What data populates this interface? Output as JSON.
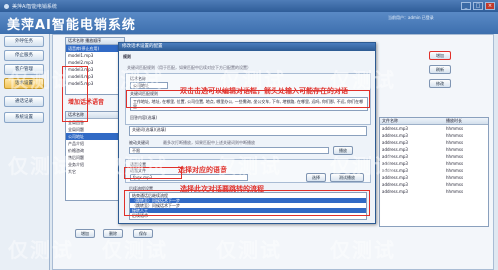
{
  "window": {
    "title": "美萍AI智能电销系统",
    "min": "_",
    "max": "□",
    "close": "×"
  },
  "app_title": "美萍AI智能电销系统",
  "user_info": "当前用户：admin  已登录",
  "sidebar": [
    {
      "label": "外呼任务"
    },
    {
      "label": "停止服务"
    },
    {
      "label": "客户管理"
    },
    {
      "label": "话术设置"
    },
    {
      "label": "通话记录"
    },
    {
      "label": "系统设置"
    }
  ],
  "left_table": {
    "header": "话术名称  播放顺序",
    "subheader": "语音库(停止应用)",
    "rows": [
      "model1.mp3",
      "model2.mp3",
      "model3.mp3",
      "model4.mp3",
      "model5.mp3"
    ]
  },
  "left_table2": {
    "header": "话术名称",
    "rows": [
      "全局回答",
      "全局问题",
      "公司地址",
      "产品介绍",
      "价格咨询",
      "售后问题",
      "业务介绍",
      "其它"
    ]
  },
  "right_table": {
    "headers": [
      "文件名称",
      "播放时长"
    ],
    "rows": [
      {
        "name": "address.mp3",
        "dur": "hhmmss"
      },
      {
        "name": "address.mp3",
        "dur": "hhmmss"
      },
      {
        "name": "address.mp3",
        "dur": "hhmmss"
      },
      {
        "name": "address.mp3",
        "dur": "hhmmss"
      },
      {
        "name": "address.mp3",
        "dur": "hhmmss"
      },
      {
        "name": "address.mp3",
        "dur": "hhmmss"
      },
      {
        "name": "address.mp3",
        "dur": "hhmmss"
      },
      {
        "name": "address.mp3",
        "dur": "hhmmss"
      },
      {
        "name": "address.mp3",
        "dur": "hhmmss"
      },
      {
        "name": "address.mp3",
        "dur": "hhmmss"
      }
    ]
  },
  "top_buttons": {
    "add": "增加",
    "refresh": "刷新",
    "edit": "修改"
  },
  "bottom_buttons": {
    "add": "增加",
    "delete": "删除",
    "save": "保存"
  },
  "dialog": {
    "title": "修改话术设置的配置",
    "section_title": "规则",
    "tip": "关键词匹配规则（用于匹配，如果匹配中后续对应下方已配置的设置）",
    "field1_label": "话术名称",
    "field1_value": "公司地址",
    "keyword_label": "关键词匹配规则",
    "keywords": "工作地址, 地址, 在哪里, 位置, 公司位置, 地点, 哪里办公, 一些需询, 坐公交车, 下车, 地铁路, 在哪里, 远吗, 你们那, 不远, 你们在哪里",
    "answer_label": "回答内容(选填)",
    "answer_value": "关键词(选填)(选填)",
    "repeat_label": "重复次数",
    "repeat_value": "不限",
    "judge_label": "被动关键词",
    "judge_value": "最多次打断播放，如果匹配中上述关键词则中断播放",
    "play_label": "播放",
    "voice_section": "语音设置",
    "voice_file_label": "语音文件",
    "voice_file_value": "fpqx.mp3",
    "voice_btn_select": "选择",
    "voice_btn_test": "测试播放",
    "flow_label": "后续流程设置",
    "flow_rows": [
      "结束通话后继续流程",
      "（跳转至）问候话术下一步",
      "（跳转至）问候话术下一步",
      "接转人工",
      "后续话术"
    ],
    "ok": "确定",
    "cancel": "取消"
  },
  "annotations": {
    "a1": "增加话术语音",
    "a2": "双击击选可以编辑对话框，箭头处输入可能存在的对话",
    "a3": "选择对应的语音",
    "a4": "选择此次对话要跳转的流程"
  },
  "watermarks": [
    "仅测试",
    "仅测试",
    "仅测试",
    "仅测试",
    "仅测试",
    "仅测试",
    "仅测试",
    "仅测试",
    "仅测试",
    "仅测试",
    "仅测试",
    "仅测试"
  ]
}
